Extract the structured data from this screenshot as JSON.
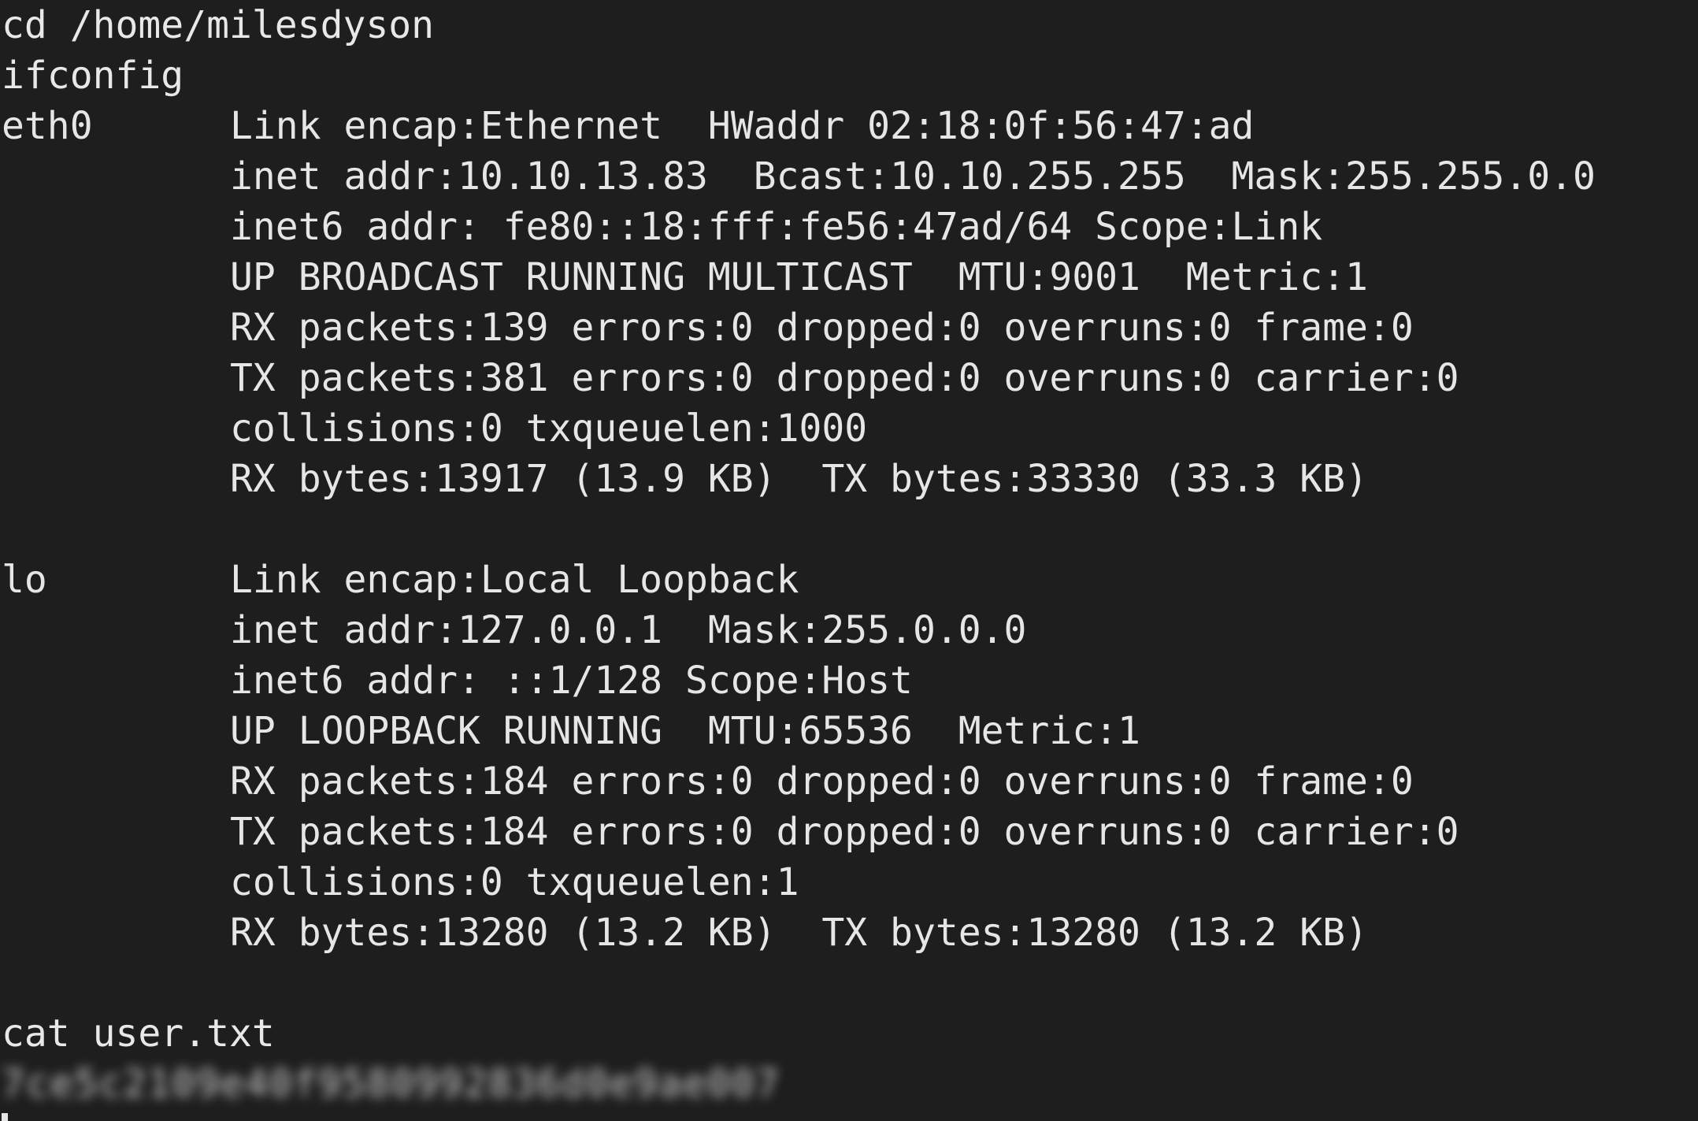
{
  "terminal": {
    "cmd_cd": "cd /home/milesdyson",
    "cmd_ifconfig": "ifconfig",
    "eth0": {
      "name": "eth0",
      "lines": [
        "Link encap:Ethernet  HWaddr 02:18:0f:56:47:ad",
        "inet addr:10.10.13.83  Bcast:10.10.255.255  Mask:255.255.0.0",
        "inet6 addr: fe80::18:fff:fe56:47ad/64 Scope:Link",
        "UP BROADCAST RUNNING MULTICAST  MTU:9001  Metric:1",
        "RX packets:139 errors:0 dropped:0 overruns:0 frame:0",
        "TX packets:381 errors:0 dropped:0 overruns:0 carrier:0",
        "collisions:0 txqueuelen:1000",
        "RX bytes:13917 (13.9 KB)  TX bytes:33330 (33.3 KB)"
      ]
    },
    "lo": {
      "name": "lo",
      "lines": [
        "Link encap:Local Loopback",
        "inet addr:127.0.0.1  Mask:255.0.0.0",
        "inet6 addr: ::1/128 Scope:Host",
        "UP LOOPBACK RUNNING  MTU:65536  Metric:1",
        "RX packets:184 errors:0 dropped:0 overruns:0 frame:0",
        "TX packets:184 errors:0 dropped:0 overruns:0 carrier:0",
        "collisions:0 txqueuelen:1",
        "RX bytes:13280 (13.2 KB)  TX bytes:13280 (13.2 KB)"
      ]
    },
    "cmd_cat": "cat user.txt",
    "user_flag_redacted": "7ce5c2109e40f9580992836d0e9ae007",
    "colors": {
      "background": "#1e1e1e",
      "foreground": "#e6e6e6"
    }
  }
}
